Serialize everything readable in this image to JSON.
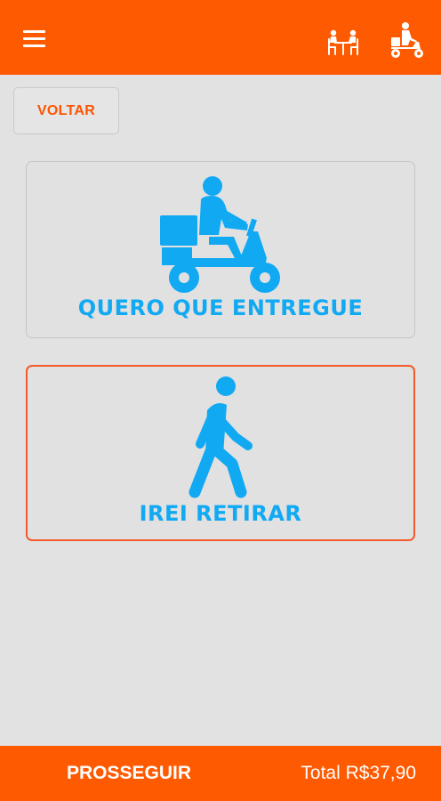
{
  "header": {
    "menu_icon": "hamburger-menu-icon",
    "dine_in_icon": "dine-in-table-icon",
    "delivery_icon": "delivery-scooter-icon"
  },
  "back_button": {
    "label": "VOLTAR"
  },
  "options": [
    {
      "id": "delivery",
      "label": "QUERO QUE ENTREGUE",
      "icon": "delivery-scooter-icon",
      "selected": false
    },
    {
      "id": "pickup",
      "label": "IREI RETIRAR",
      "icon": "walking-person-icon",
      "selected": true
    }
  ],
  "footer": {
    "proceed_label": "PROSSEGUIR",
    "total": "Total R$37,90"
  },
  "colors": {
    "brand_orange": "#fe5a01",
    "icon_blue": "#12a9f3",
    "selected_border": "#f45a2b",
    "background": "#e2e2e2"
  }
}
